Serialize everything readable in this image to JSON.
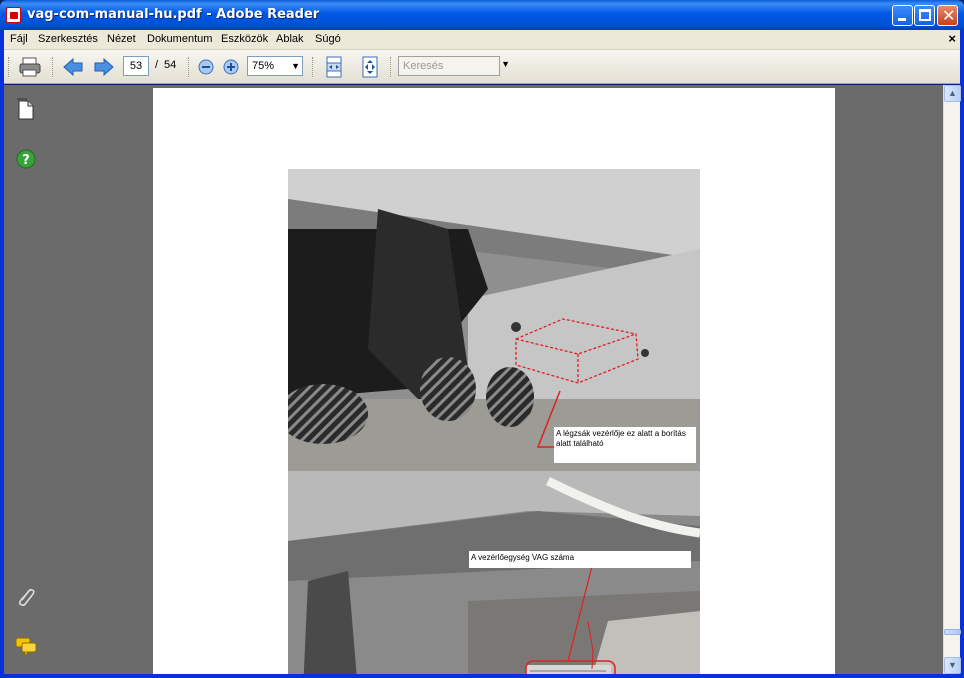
{
  "window": {
    "title": "vag-com-manual-hu.pdf - Adobe Reader"
  },
  "menu": {
    "items": [
      "Fájl",
      "Szerkesztés",
      "Nézet",
      "Dokumentum",
      "Eszközök",
      "Ablak",
      "Súgó"
    ],
    "close_doc": "×"
  },
  "toolbar": {
    "current_page": "53",
    "page_separator": "/",
    "total_pages": "54",
    "zoom": "75%",
    "search_placeholder": "Keresés"
  },
  "document": {
    "callout_airbag": "A légzsák vezérlője ez alatt a borítás alatt található",
    "callout_vag": "A vezérlőegység VAG száma"
  },
  "icons": {
    "print": "print-icon",
    "prev": "previous-page-icon",
    "next": "next-page-icon",
    "zoom_out": "zoom-out-icon",
    "zoom_in": "zoom-in-icon",
    "fit_width": "fit-width-icon",
    "fit_page": "fit-page-icon",
    "pages_panel": "pages-panel-icon",
    "help": "help-icon",
    "attachments": "paperclip-icon",
    "comments": "comments-icon"
  },
  "colors": {
    "titlebar": "#0054e3",
    "menubar": "#ece9d8",
    "document_bg": "#6b6b6b",
    "annotation_red": "#e02020",
    "help_green": "#3aa23a"
  }
}
